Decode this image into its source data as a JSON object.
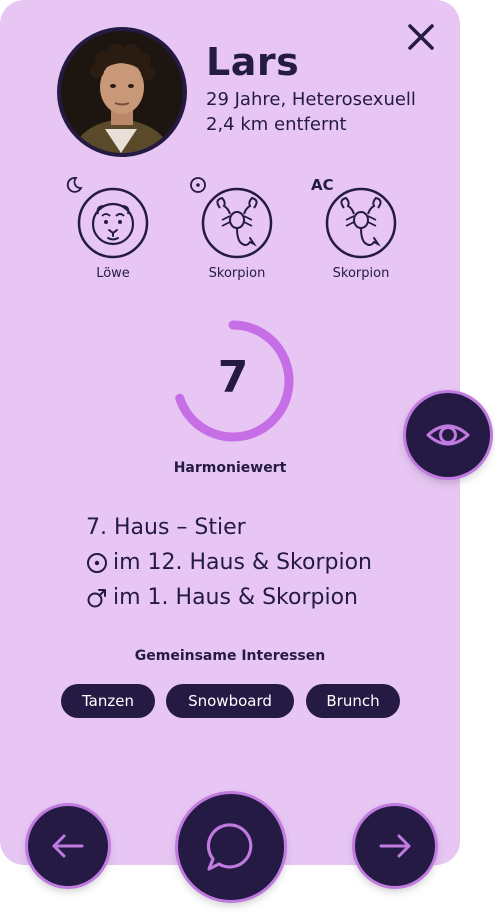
{
  "profile": {
    "name": "Lars",
    "details": "29 Jahre, Heterosexuell",
    "distance": "2,4 km entfernt"
  },
  "zodiac": [
    {
      "badge": "moon-icon",
      "badge_text": "",
      "sign": "Löwe",
      "icon": "lion-icon"
    },
    {
      "badge": "sun-icon",
      "badge_text": "",
      "sign": "Skorpion",
      "icon": "scorpion-icon"
    },
    {
      "badge": "text",
      "badge_text": "AC",
      "sign": "Skorpion",
      "icon": "scorpion-icon"
    }
  ],
  "harmony": {
    "value": "7",
    "max": 10,
    "label": "Harmoniewert"
  },
  "aspects": [
    {
      "symbol": "",
      "text": "7. Haus – Stier"
    },
    {
      "symbol": "sun-icon",
      "text": "im 12. Haus & Skorpion"
    },
    {
      "symbol": "mars-icon",
      "text": "im 1. Haus & Skorpion"
    }
  ],
  "interests": {
    "title": "Gemeinsame Interessen",
    "items": [
      "Tanzen",
      "Snowboard",
      "Brunch"
    ]
  },
  "colors": {
    "card_background": "#e8c6f4",
    "dark": "#241a44",
    "accent": "#c07ae0",
    "progress": "#c56ee6"
  }
}
